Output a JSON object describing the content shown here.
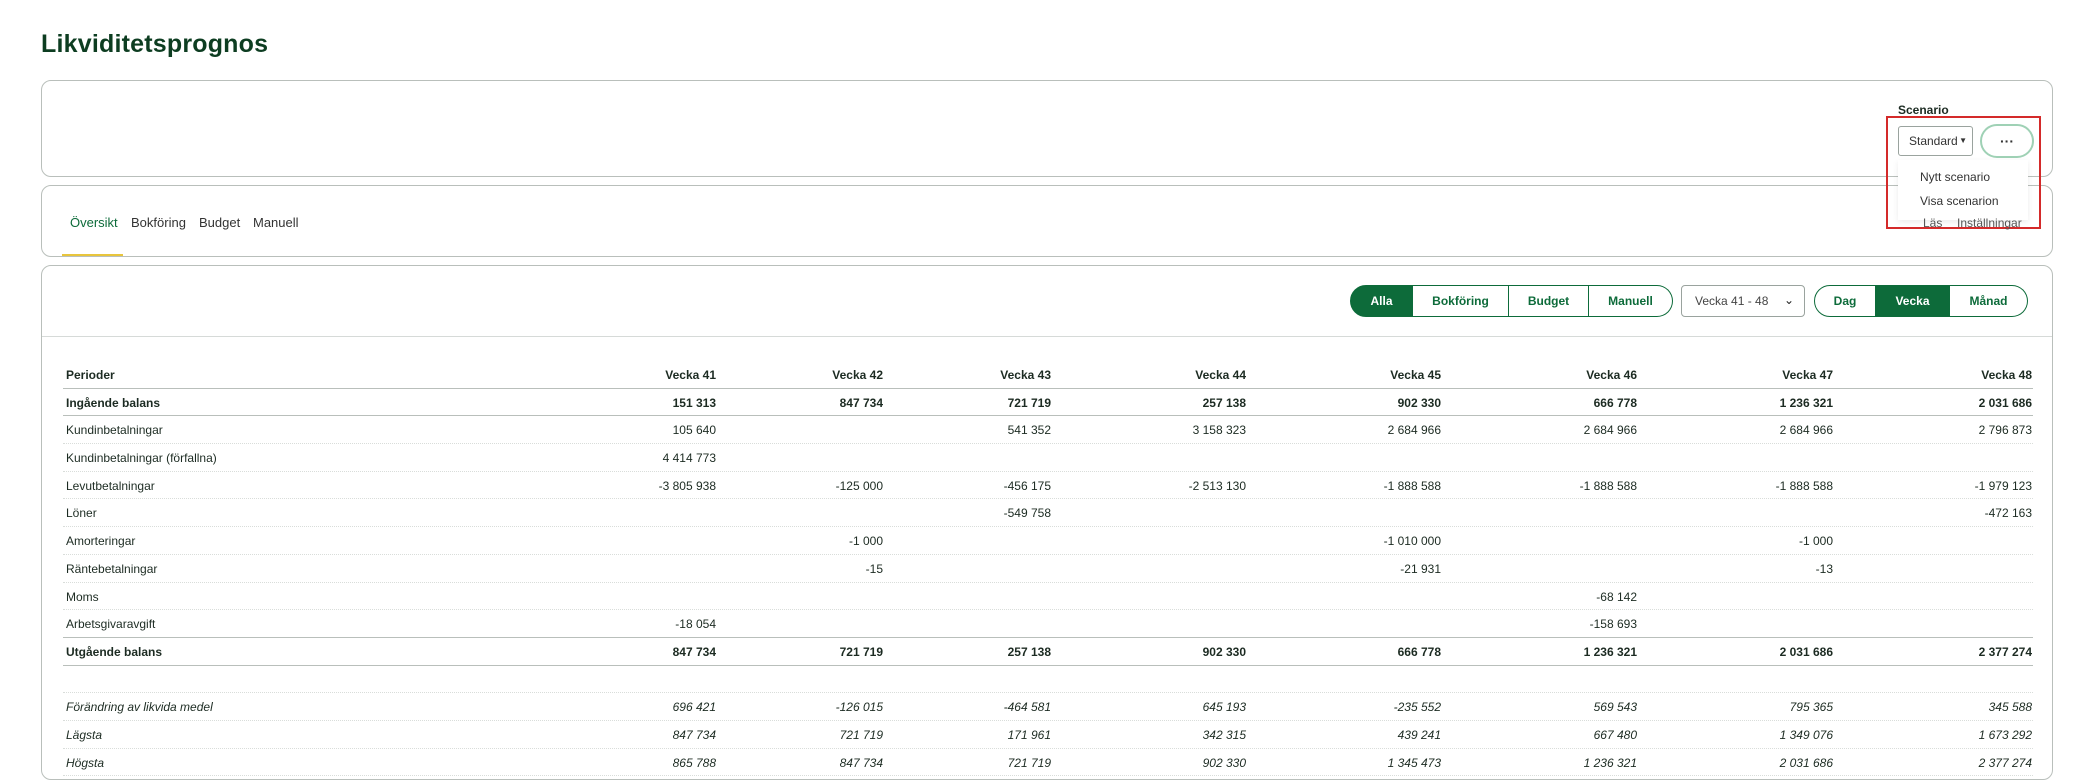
{
  "page": {
    "title": "Likviditetsprognos"
  },
  "scenario": {
    "label": "Scenario",
    "selected": "Standard",
    "more_label": "···",
    "menu": [
      "Nytt scenario",
      "Visa scenarion"
    ]
  },
  "tabs": [
    {
      "label": "Översikt",
      "active": true
    },
    {
      "label": "Bokföring",
      "active": false
    },
    {
      "label": "Budget",
      "active": false
    },
    {
      "label": "Manuell",
      "active": false
    }
  ],
  "right_links": [
    "Läs",
    "Inställningar"
  ],
  "filters": {
    "source": [
      "Alla",
      "Bokföring",
      "Budget",
      "Manuell"
    ],
    "source_active": "Alla",
    "period_range": "Vecka 41 - 48",
    "granularity": [
      "Dag",
      "Vecka",
      "Månad"
    ],
    "granularity_active": "Vecka"
  },
  "table": {
    "header_label": "Perioder",
    "columns": [
      "Vecka 41",
      "Vecka 42",
      "Vecka 43",
      "Vecka 44",
      "Vecka 45",
      "Vecka 46",
      "Vecka 47",
      "Vecka 48"
    ],
    "rows": [
      {
        "label": "Ingående balans",
        "style": "bold",
        "values": [
          "151 313",
          "847 734",
          "721 719",
          "257 138",
          "902 330",
          "666 778",
          "1 236 321",
          "2 031 686"
        ]
      },
      {
        "label": "Kundinbetalningar",
        "style": "",
        "values": [
          "105 640",
          "",
          "541 352",
          "3 158 323",
          "2 684 966",
          "2 684 966",
          "2 684 966",
          "2 796 873"
        ]
      },
      {
        "label": "Kundinbetalningar (förfallna)",
        "style": "",
        "values": [
          "4 414 773",
          "",
          "",
          "",
          "",
          "",
          "",
          ""
        ]
      },
      {
        "label": "Levutbetalningar",
        "style": "",
        "values": [
          "-3 805 938",
          "-125 000",
          "-456 175",
          "-2 513 130",
          "-1 888 588",
          "-1 888 588",
          "-1 888 588",
          "-1 979 123"
        ]
      },
      {
        "label": "Löner",
        "style": "",
        "values": [
          "",
          "",
          "-549 758",
          "",
          "",
          "",
          "",
          "-472 163"
        ]
      },
      {
        "label": "Amorteringar",
        "style": "",
        "values": [
          "",
          "-1 000",
          "",
          "",
          "-1 010 000",
          "",
          "-1 000",
          ""
        ]
      },
      {
        "label": "Räntebetalningar",
        "style": "",
        "values": [
          "",
          "-15",
          "",
          "",
          "-21 931",
          "",
          "-13",
          ""
        ]
      },
      {
        "label": "Moms",
        "style": "",
        "values": [
          "",
          "",
          "",
          "",
          "",
          "-68 142",
          "",
          ""
        ]
      },
      {
        "label": "Arbetsgivaravgift",
        "style": "",
        "values": [
          "-18 054",
          "",
          "",
          "",
          "",
          "-158 693",
          "",
          ""
        ]
      },
      {
        "label": "Utgående balans",
        "style": "bold",
        "values": [
          "847 734",
          "721 719",
          "257 138",
          "902 330",
          "666 778",
          "1 236 321",
          "2 031 686",
          "2 377 274"
        ]
      },
      {
        "label": "",
        "style": "",
        "values": [
          "",
          "",
          "",
          "",
          "",
          "",
          "",
          ""
        ]
      },
      {
        "label": "Förändring av likvida medel",
        "style": "italic",
        "values": [
          "696 421",
          "-126 015",
          "-464 581",
          "645 193",
          "-235 552",
          "569 543",
          "795 365",
          "345 588"
        ]
      },
      {
        "label": "Lägsta",
        "style": "italic",
        "values": [
          "847 734",
          "721 719",
          "171 961",
          "342 315",
          "439 241",
          "667 480",
          "1 349 076",
          "1 673 292"
        ]
      },
      {
        "label": "Högsta",
        "style": "italic",
        "values": [
          "865 788",
          "847 734",
          "721 719",
          "902 330",
          "1 345 473",
          "1 236 321",
          "2 031 686",
          "2 377 274"
        ]
      }
    ]
  },
  "colors": {
    "accent": "#0d6b3a",
    "highlight": "#d42a2a",
    "tab_underline": "#e8c53c"
  }
}
